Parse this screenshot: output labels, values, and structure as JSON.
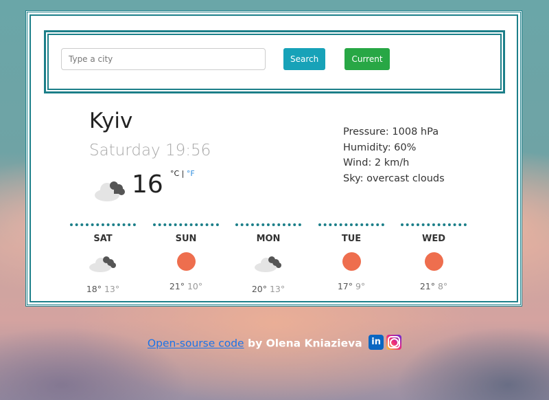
{
  "search": {
    "placeholder": "Type a city",
    "search_label": "Search",
    "current_label": "Current"
  },
  "current": {
    "city": "Kyiv",
    "datetime": "Saturday 19:56",
    "temperature": "16",
    "unit_c": "°C",
    "unit_sep": " | ",
    "unit_f": "°F",
    "icon": "broken-clouds-icon",
    "pressure": "Pressure: 1008 hPa",
    "humidity": "Humidity: 60%",
    "wind": "Wind: 2 km/h",
    "sky": "Sky: overcast clouds"
  },
  "forecast": [
    {
      "day": "SAT",
      "icon": "clouds-icon",
      "max": "18°",
      "min": "13°"
    },
    {
      "day": "SUN",
      "icon": "sun-icon",
      "max": "21°",
      "min": "10°"
    },
    {
      "day": "MON",
      "icon": "clouds-icon",
      "max": "20°",
      "min": "13°"
    },
    {
      "day": "TUE",
      "icon": "sun-icon",
      "max": "17°",
      "min": "9°"
    },
    {
      "day": "WED",
      "icon": "sun-icon",
      "max": "21°",
      "min": "8°"
    }
  ],
  "footer": {
    "source_link": "Open-sourse code",
    "author": " by Olena Kniazieva ",
    "linkedin": "in",
    "linkedin_icon": "linkedin-icon",
    "instagram_icon": "instagram-icon"
  },
  "colors": {
    "accent": "#1c7f89",
    "search_btn": "#17a2b8",
    "current_btn": "#28a745",
    "sun": "#ee6e4e"
  }
}
